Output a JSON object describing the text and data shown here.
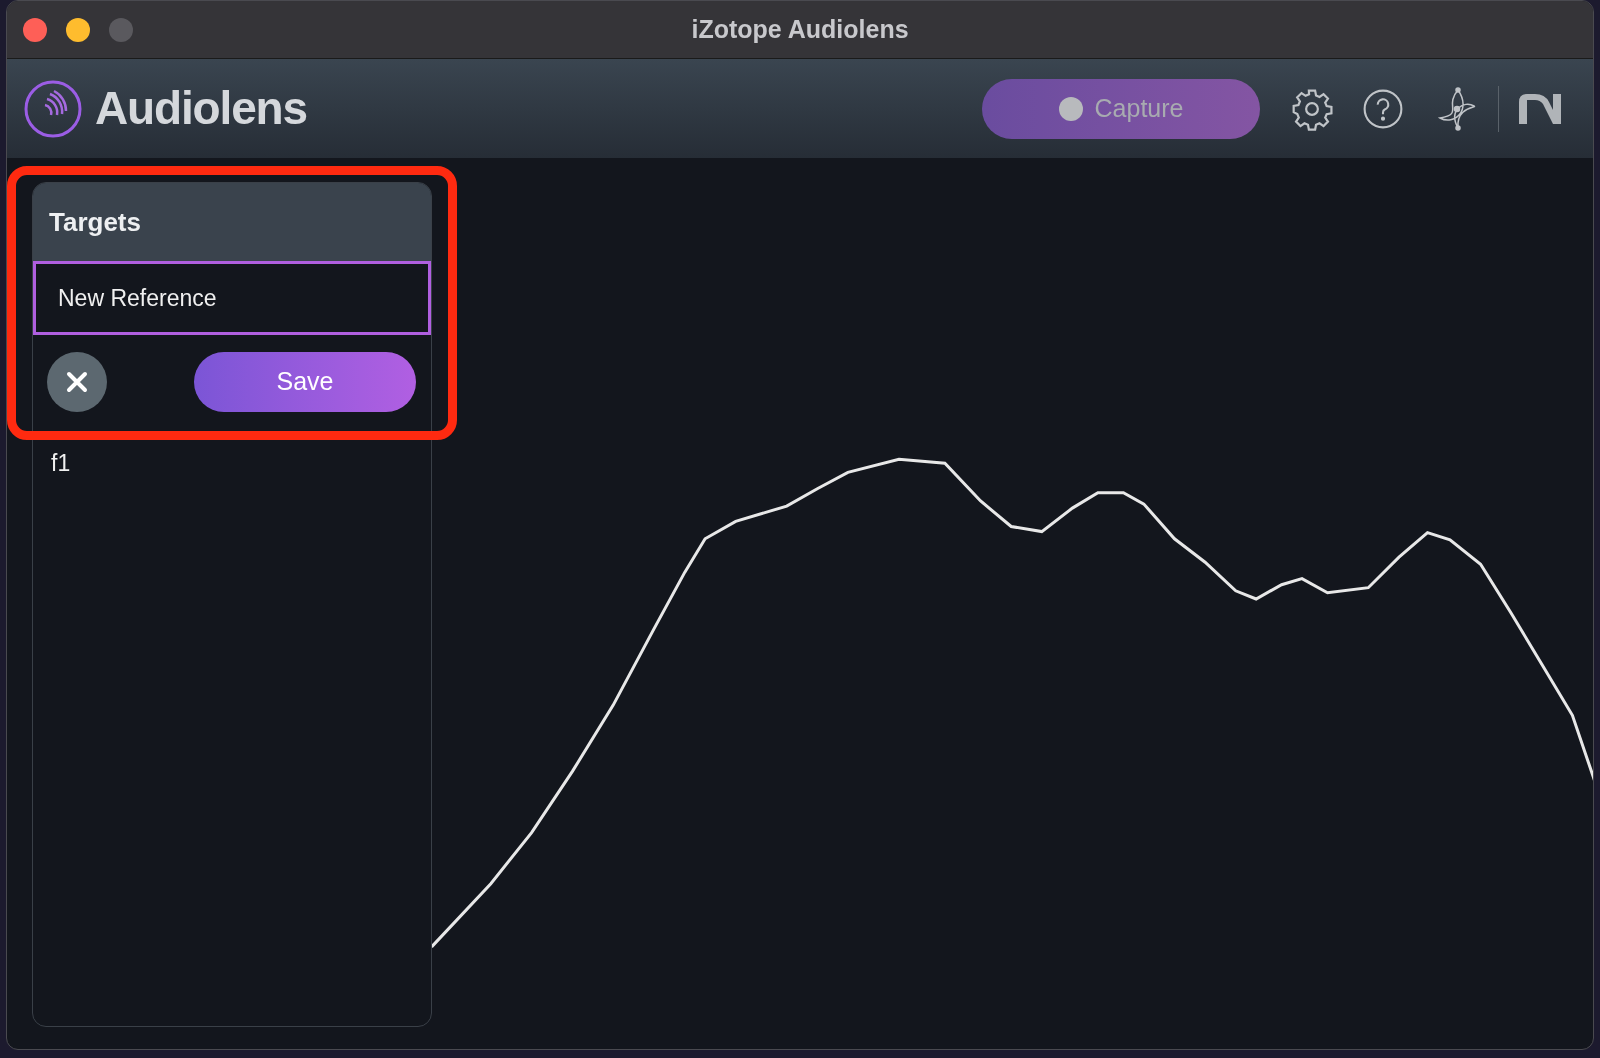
{
  "window": {
    "title": "iZotope Audiolens"
  },
  "header": {
    "app_name": "Audiolens",
    "capture_button": {
      "label": "Capture",
      "recording": false
    }
  },
  "targets_panel": {
    "title": "Targets",
    "name_field": {
      "value": "New Reference",
      "focused": true
    },
    "save_button": "Save",
    "items": [
      {
        "label": "f1"
      }
    ]
  },
  "highlight": {
    "shown": true
  }
}
